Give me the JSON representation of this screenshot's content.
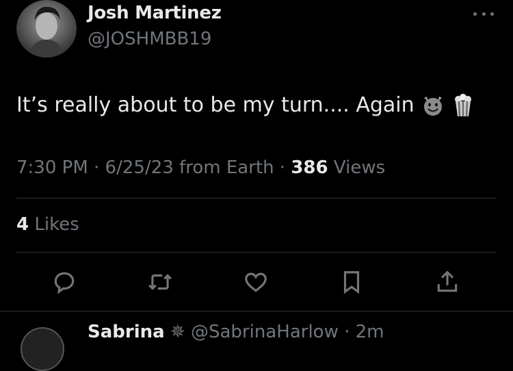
{
  "author": {
    "name": "Josh Martinez",
    "handle": "@JOSHMBB19"
  },
  "tweet": {
    "text": "It’s really about to be my turn.... Again",
    "emojis": [
      "smiling-imp-emoji",
      "popcorn-emoji"
    ]
  },
  "meta": {
    "time_date": "7:30 PM · 6/25/23 from Earth · ",
    "views_count": "386",
    "views_label": " Views"
  },
  "stats": {
    "likes_count": "4",
    "likes_label": " Likes"
  },
  "actions": [
    "reply-icon",
    "retweet-icon",
    "like-icon",
    "bookmark-icon",
    "share-icon"
  ],
  "reply_preview": {
    "name": "Sabrina",
    "handle": "@SabrinaHarlow · 2m"
  },
  "colors": {
    "background": "#000000",
    "text_primary": "#e7e9ea",
    "text_secondary": "#71767b",
    "divider": "#2f3336"
  }
}
